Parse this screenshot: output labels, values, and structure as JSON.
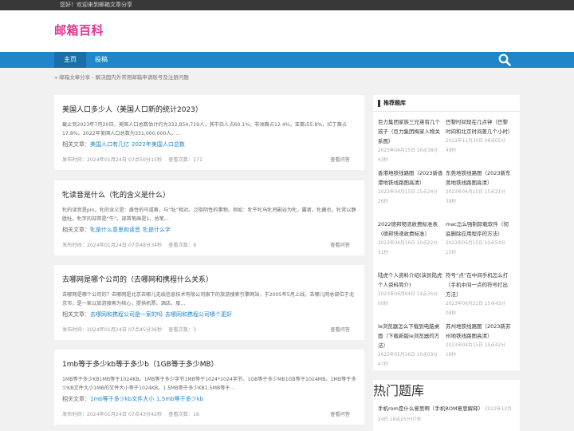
{
  "topbar": {
    "welcome": "您好！欢迎来到邮箱文章分享"
  },
  "site": {
    "logo": "邮箱百科"
  },
  "nav": {
    "items": [
      {
        "label": "主页"
      },
      {
        "label": "投稿"
      }
    ]
  },
  "breadcrumb": {
    "text": "邮箱文章分享 - 解决国内外常用邮箱申请账号及注册问题"
  },
  "articles": [
    {
      "title": "美国人口多少人（美国人口新的统计2023）",
      "summary": "截止到2023年7月20日，美国人口总数估计约为332,854,719人，其中白人占60.1%，非洲裔占12.4%，亚裔占5.8%，拉丁裔占17.8%。2022年美国人口总数为331,000,000人。...",
      "rel_label": "相关文章：",
      "links": [
        "美国人口有几亿",
        "2022年美国人口总数"
      ],
      "time": "发布时间：2024年01月24日 07点50分15秒",
      "views": "查看次数：171",
      "more": "查看问答"
    },
    {
      "title": "牝读音是什么（牝的含义是什么）",
      "summary": "牝的读音是pìn。牝的含义是：雌性的鸟或兽，与“牡”相对。泛指阴性的事物。例如：牝牛牝马牝鸡副谷为牝，翼者，牝藏也，牝常以静胜牡。牝字的部首是“牛”，部首笔画是1，总笔...",
      "rel_label": "相关文章：",
      "links": [
        "牝是什么意思和读音",
        "牝是什么字"
      ],
      "time": "发布时间：2024年01月24日 07点48分34秒",
      "views": "查看次数：9",
      "more": "查看问答"
    },
    {
      "title": "去哪网是哪个公司的（去哪网和携程什么关系）",
      "summary": "去哪网是哪个公司的？去哪网是北京去哪儿无线信息技术有限公司旗下的旅游搜索引擎网站，于2005年5月上线，去哪儿网总部位于北京市，是一家以旅游搜索为核心，提供机票、酒店、度...",
      "rel_label": "相关文章：",
      "links": [
        "去哪网和携程公司是一家的吗",
        "去哪网和携程公司哪个更好"
      ],
      "time": "发布时间：2024年01月24日 07点45分36秒",
      "views": "查看次数：3",
      "more": "查看问答"
    },
    {
      "title": "1mb等于多少kb等于多少b（1GB等于多少MB）",
      "summary": "1MB等于多少KB1MB等于1024KB。1MB等于多少字节1MB等于1024*1024字节。1GB等于多少MB1GB等于1024MB。1MB等于多少KB文件大小1MB的文件大小等于1024KB。1.5MB等于多少KB1.5MB等于...",
      "rel_label": "相关文章：",
      "links": [
        "1mb等于多少kb文件大小",
        "1.5mb等于多少kb"
      ],
      "time": "发布时间：2024年01月24日 07点43分42秒",
      "views": "查看次数：18",
      "more": "查看问答"
    }
  ],
  "sidebar": {
    "rec_title": "推荐题库",
    "rec": [
      {
        "t": "巨力集团家族三兄弟有几个孩子（巨力集团梅家人物关系图）",
        "d": "2023年04月15日 16点38分43秒"
      },
      {
        "t": "巴黎时间现在几点钟（巴黎时间和北京时间差几个小时）",
        "d": "2023年11月30日 06点05分49秒"
      },
      {
        "t": "香港地铁线路图（2023新香港地铁线路图高清）",
        "d": "2023年04月15日 15点24分26秒"
      },
      {
        "t": "东莞地铁线路图（2023新东莞地铁线路图高清）",
        "d": "2023年04月15日 15点21分39秒"
      },
      {
        "t": "2022德邦物流收费标准表（德邦快递收费标准）",
        "d": "2023年04月16日 10点22分51秒"
      },
      {
        "t": "mac怎么强制卸载软件（彻底删除应用程序的方法）",
        "d": "2023年05月15日 10点54分15秒"
      },
      {
        "t": "陆虎个人资料介绍(演员陆虎个人资料简介)",
        "d": "2023年06月04日 14点35分00秒"
      },
      {
        "t": "符号“点”在中间手机怎么打（手机中间一点的符号打出方法）",
        "d": "2023年06月21日 15点43分09秒"
      },
      {
        "t": "ie浏览器怎么下载到电脑桌面（下载新版ie浏览器的方法）",
        "d": "2023年05月16日 10点03分47秒"
      },
      {
        "t": "苏州地铁线路图（2023新苏州地铁线路图高清）",
        "d": "2023年04月15日 15点42分18秒"
      }
    ],
    "hot_title": "热门题库",
    "hot": [
      {
        "t": "手机rom是什么意思啊（手机ROM意思解释）",
        "d": "2022年12月24日 18点25分07秒"
      }
    ]
  },
  "colors": {
    "brand": "#e0338f",
    "nav": "#1e86c9",
    "link": "#1e86c9"
  }
}
